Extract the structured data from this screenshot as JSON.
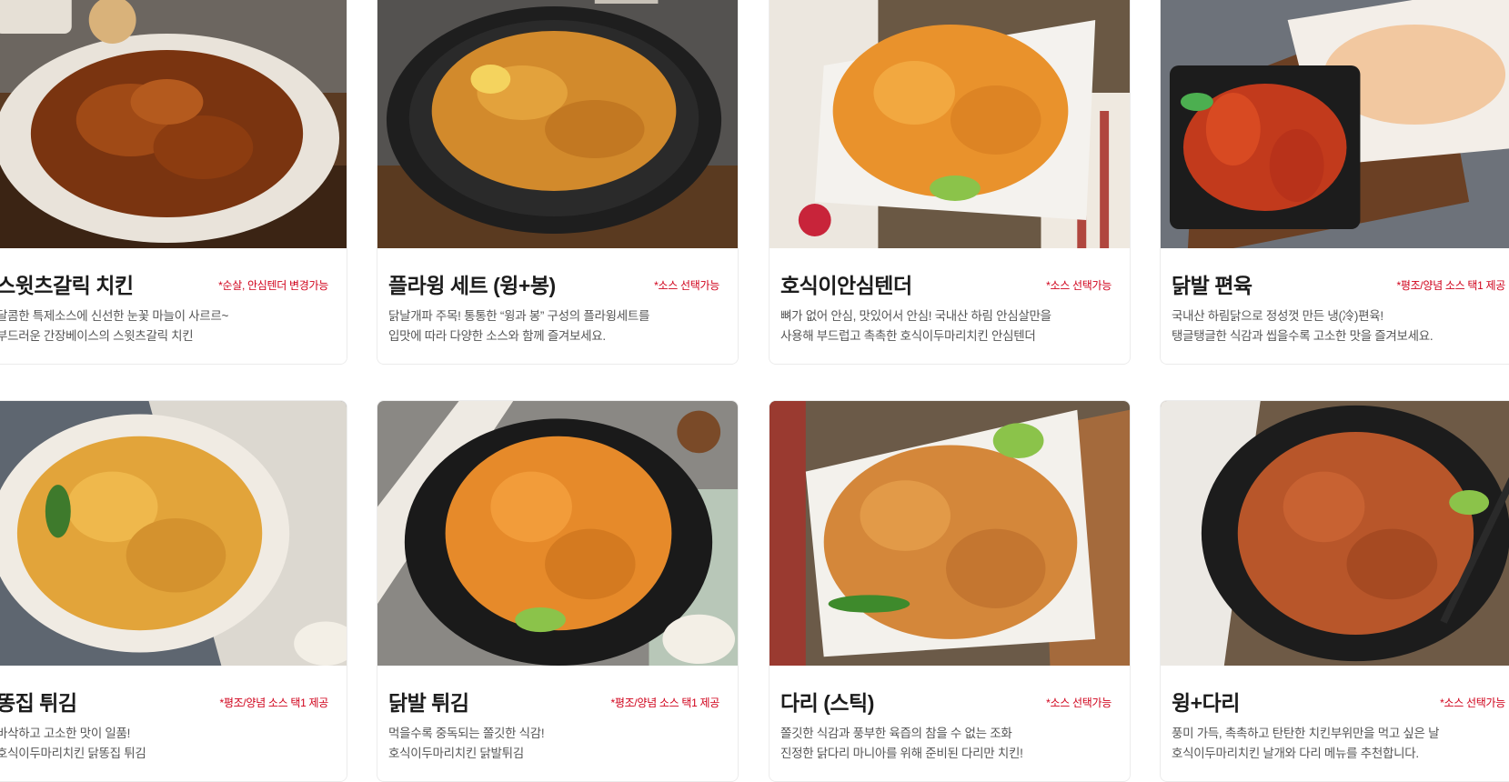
{
  "products": [
    {
      "title": "스윗츠갈릭 치킨",
      "badge": "*순살, 안심텐더 변경가능",
      "desc_line1": "달콤한 특제소스에 신선한 눈꽃 마늘이 사르르~",
      "desc_line2": "부드러운 간장베이스의 스윗츠갈릭 치킨",
      "image_icon": "garlic-chicken-photo"
    },
    {
      "title": "플라윙 세트 (윙+봉)",
      "badge": "*소스 선택가능",
      "desc_line1": "닭날개파 주목! 통통한 “윙과 봉” 구성의 플라윙세트를",
      "desc_line2": "입맛에 따라 다양한 소스와 함께 즐겨보세요.",
      "image_icon": "wing-set-photo"
    },
    {
      "title": "호식이안심텐더",
      "badge": "*소스 선택가능",
      "desc_line1": "뼈가 없어 안심, 맛있어서 안심! 국내산 하림 안심살만을",
      "desc_line2": "사용해 부드럽고 촉촉한 호식이두마리치킨 안심텐더",
      "image_icon": "tender-photo"
    },
    {
      "title": "닭발 편육",
      "badge": "*평조/양념 소스 택1 제공",
      "desc_line1": "국내산 하림닭으로 정성껏 만든 냉(冷)편육!",
      "desc_line2": "탱글탱글한 식감과 씹을수록 고소한 맛을 즐겨보세요.",
      "image_icon": "feet-pressed-meat-photo"
    },
    {
      "title": "똥집 튀김",
      "badge": "*평조/양념 소스 택1 제공",
      "desc_line1": "바삭하고 고소한 맛이 일품!",
      "desc_line2": "호식이두마리치킨 닭똥집 튀김",
      "image_icon": "gizzard-photo"
    },
    {
      "title": "닭발 튀김",
      "badge": "*평조/양념 소스 택1 제공",
      "desc_line1": "먹을수록 중독되는 쫄깃한 식감!",
      "desc_line2": "호식이두마리치킨 닭발튀김",
      "image_icon": "fried-feet-photo"
    },
    {
      "title": "다리 (스틱)",
      "badge": "*소스 선택가능",
      "desc_line1": "쫄깃한 식감과 풍부한 육즙의 참을 수 없는 조화",
      "desc_line2": "진정한 닭다리 마니아를 위해 준비된 다리만 치킨!",
      "image_icon": "drumstick-photo"
    },
    {
      "title": "윙+다리",
      "badge": "*소스 선택가능",
      "desc_line1": "풍미 가득, 촉촉하고 탄탄한 치킨부위만을 먹고 싶은 날",
      "desc_line2": "호식이두마리치킨 날개와 다리 메뉴를 추천합니다.",
      "image_icon": "wing-leg-photo"
    }
  ],
  "colors": {
    "badge": "#d0021b",
    "title": "#1c1c1c",
    "desc": "#555555",
    "card_border": "#ececec"
  }
}
